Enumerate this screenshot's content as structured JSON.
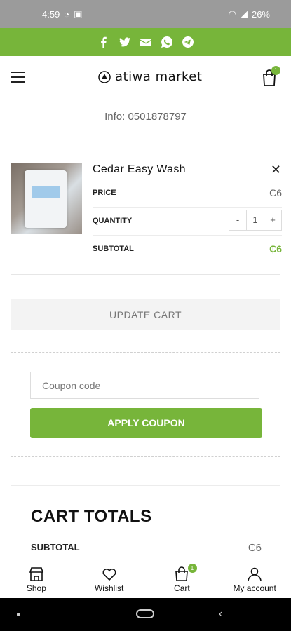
{
  "status": {
    "time": "4:59",
    "battery": "26%"
  },
  "social": {
    "icons": [
      "facebook-icon",
      "twitter-icon",
      "email-icon",
      "whatsapp-icon",
      "telegram-icon"
    ]
  },
  "header": {
    "brand": "atiwa market",
    "cart_count": "1"
  },
  "info": "Info: 0501878797",
  "cart_item": {
    "name": "Cedar Easy Wash",
    "price_label": "PRICE",
    "price": "₵6",
    "quantity_label": "QUANTITY",
    "quantity": "1",
    "minus": "-",
    "plus": "+",
    "subtotal_label": "SUBTOTAL",
    "subtotal": "₵6",
    "remove": "✕"
  },
  "update_cart": "UPDATE CART",
  "coupon": {
    "placeholder": "Coupon code",
    "apply": "APPLY COUPON"
  },
  "totals": {
    "title": "CART TOTALS",
    "subtotal_label": "SUBTOTAL",
    "subtotal": "₵6"
  },
  "bottom_nav": [
    {
      "label": "Shop"
    },
    {
      "label": "Wishlist"
    },
    {
      "label": "Cart",
      "badge": "1"
    },
    {
      "label": "My account"
    }
  ],
  "colors": {
    "accent": "#77b53a"
  }
}
